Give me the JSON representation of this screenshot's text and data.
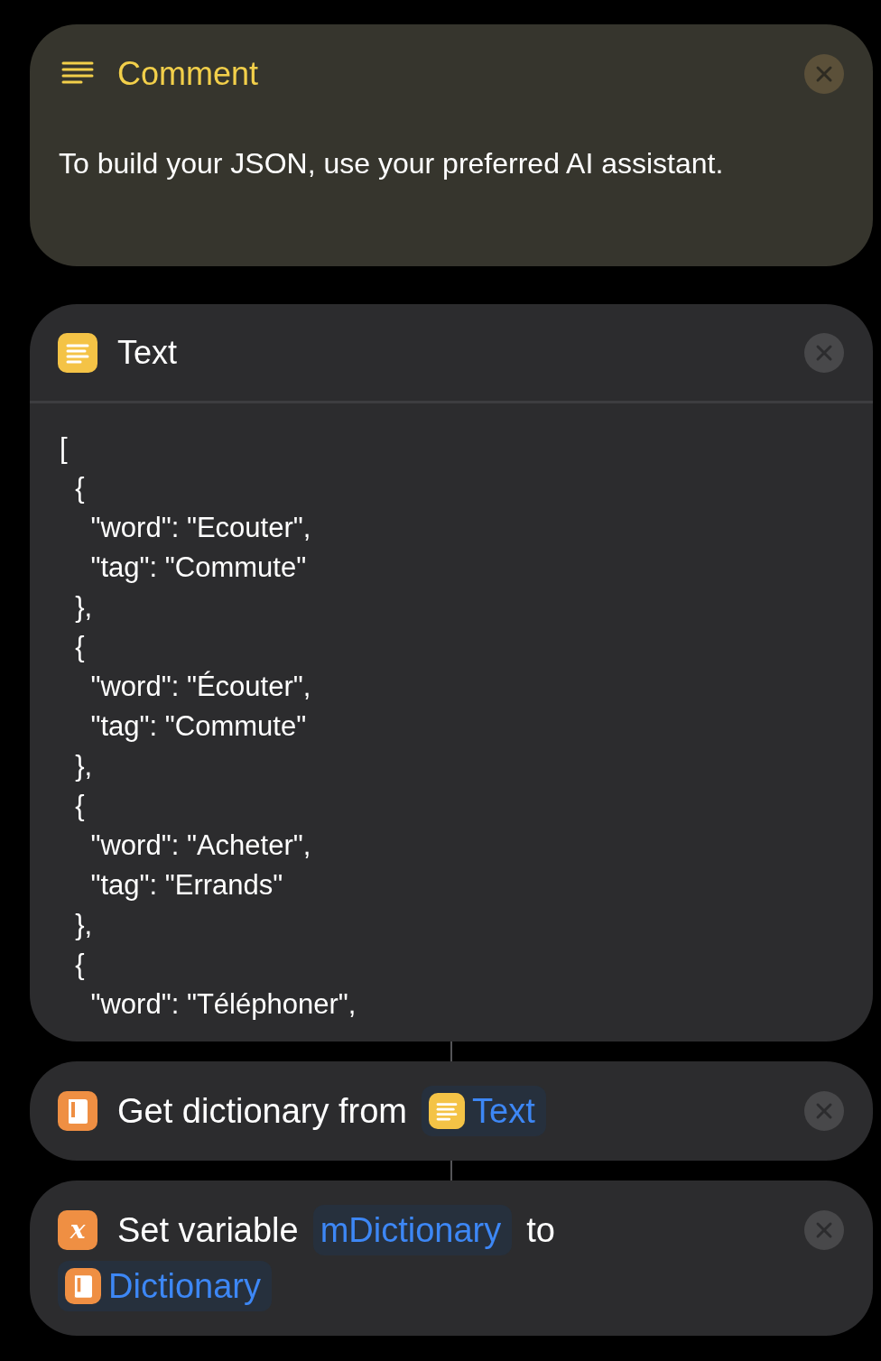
{
  "actions": [
    {
      "kind": "comment",
      "title": "Comment",
      "body": "To build your JSON, use your preferred AI assistant."
    },
    {
      "kind": "text",
      "title": "Text",
      "content": "[\n  {\n    \"word\": \"Ecouter\",\n    \"tag\": \"Commute\"\n  },\n  {\n    \"word\": \"Écouter\",\n    \"tag\": \"Commute\"\n  },\n  {\n    \"word\": \"Acheter\",\n    \"tag\": \"Errands\"\n  },\n  {\n    \"word\": \"Téléphoner\",",
      "linked": false
    },
    {
      "kind": "dictionary",
      "parts": [
        {
          "kind": "label",
          "text": "Get dictionary from"
        },
        {
          "kind": "text",
          "text": "Text"
        }
      ],
      "linked": true
    },
    {
      "kind": "variable",
      "glyph": "x",
      "parts": [
        {
          "kind": "label",
          "text": "Set variable"
        },
        {
          "kind": "named",
          "text": "mDictionary"
        },
        {
          "kind": "label",
          "text": "to"
        },
        {
          "kind": "dictionary",
          "text": "Dictionary"
        }
      ],
      "linked": true
    }
  ]
}
